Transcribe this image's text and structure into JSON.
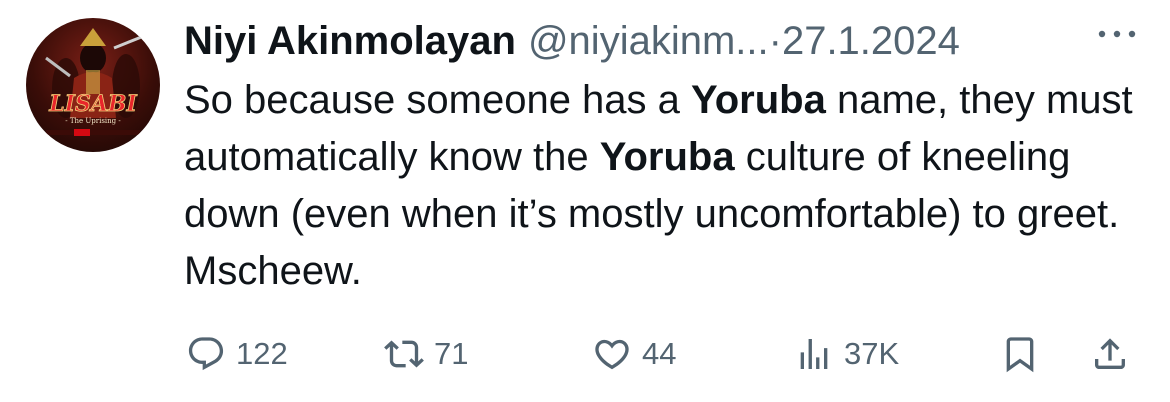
{
  "author": {
    "display_name": "Niyi Akinmolayan",
    "handle": "@niyiakinm...",
    "separator": "·",
    "date": "27.1.2024",
    "avatar_text": {
      "title": "LISABI",
      "subtitle": "- The Uprising -"
    }
  },
  "tweet": {
    "segments": [
      {
        "text": "So because someone has a ",
        "bold": false
      },
      {
        "text": "Yoruba",
        "bold": true
      },
      {
        "text": " name, they must automatically know the ",
        "bold": false
      },
      {
        "text": "Yoruba",
        "bold": true
      },
      {
        "text": " culture of kneeling down (even when it’s mostly uncomfortable) to greet. Mscheew.",
        "bold": false
      }
    ]
  },
  "actions": {
    "replies": "122",
    "retweets": "71",
    "likes": "44",
    "views": "37K"
  },
  "icons": {
    "more": "more-horizontal-icon",
    "reply": "reply-bubble-icon",
    "retweet": "retweet-arrows-icon",
    "like": "heart-icon",
    "views": "bar-chart-icon",
    "bookmark": "bookmark-icon",
    "share": "share-upload-icon"
  },
  "colors": {
    "text_primary": "#0f1419",
    "text_secondary": "#536471",
    "background": "#ffffff"
  }
}
